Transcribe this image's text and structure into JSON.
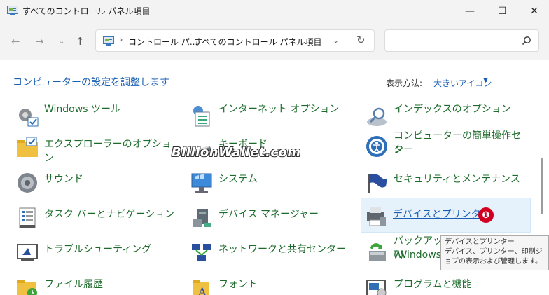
{
  "window": {
    "title": "すべてのコントロール パネル項目",
    "minimize_glyph": "—",
    "maximize_glyph": "☐",
    "close_glyph": "✕"
  },
  "nav": {
    "back_glyph": "←",
    "forward_glyph": "→",
    "recent_glyph": "⌄",
    "up_glyph": "↑"
  },
  "address": {
    "sep_glyph": "›",
    "crumbs": [
      "コントロール パ...",
      "すべてのコントロール パネル項目"
    ],
    "dropdown_glyph": "⌄",
    "refresh_glyph": "↻"
  },
  "search": {
    "placeholder": "",
    "icon": "search-icon"
  },
  "header": {
    "heading": "コンピューターの設定を調整します",
    "view_label": "表示方法:",
    "view_value": "大きいアイコン",
    "view_dropdown_glyph": "▼"
  },
  "items": [
    {
      "label": "Windows ツール",
      "icon": "windows-tools-icon"
    },
    {
      "label": "インターネット オプション",
      "icon": "internet-options-icon"
    },
    {
      "label": "インデックスのオプション",
      "icon": "indexing-options-icon"
    },
    {
      "label": "エクスプローラーのオプション",
      "icon": "explorer-options-icon"
    },
    {
      "label": "キーボード",
      "icon": "keyboard-icon"
    },
    {
      "label": "コンピューターの簡単操作センター",
      "icon": "ease-of-access-icon"
    },
    {
      "label": "サウンド",
      "icon": "sound-icon"
    },
    {
      "label": "システム",
      "icon": "system-icon"
    },
    {
      "label": "セキュリティとメンテナンス",
      "icon": "security-maintenance-icon"
    },
    {
      "label": "タスク バーとナビゲーション",
      "icon": "taskbar-icon"
    },
    {
      "label": "デバイス マネージャー",
      "icon": "device-manager-icon"
    },
    {
      "label": "デバイスとプリンター",
      "icon": "devices-printers-icon",
      "highlighted": true
    },
    {
      "label": "トラブルシューティング",
      "icon": "troubleshooting-icon"
    },
    {
      "label": "ネットワークと共有センター",
      "icon": "network-sharing-icon"
    },
    {
      "label": "バックアップと復元 (Windows 7)",
      "icon": "backup-restore-icon"
    },
    {
      "label": "ファイル履歴",
      "icon": "file-history-icon"
    },
    {
      "label": "フォント",
      "icon": "fonts-icon"
    },
    {
      "label": "プログラムと機能",
      "icon": "programs-features-icon"
    }
  ],
  "label_lines": {
    "easy": [
      "コンピューターの簡単操作セン",
      "ター"
    ],
    "backup": [
      "バックアップと復元 (Windows",
      "7)"
    ]
  },
  "badge": "❶",
  "tooltip": {
    "title": "デバイスとプリンター",
    "desc": "デバイス、プリンター、印刷ジョブの表示および管理します。"
  },
  "watermark": "BillionWallet.com",
  "colors": {
    "link_green": "#1c6b2a",
    "link_blue": "#1a5fb4",
    "badge_red": "#d1001f"
  }
}
